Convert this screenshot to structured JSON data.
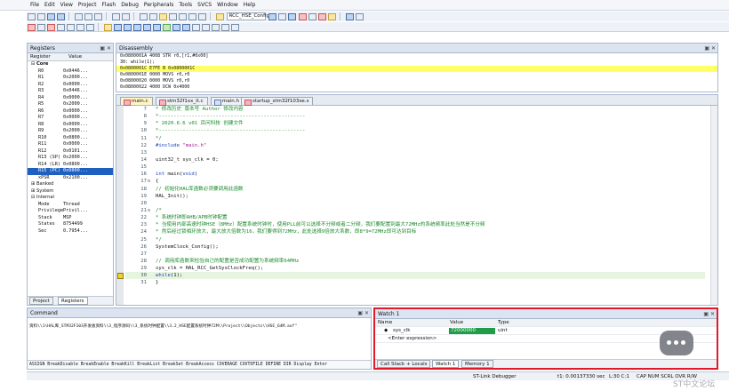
{
  "menu": [
    "File",
    "Edit",
    "View",
    "Project",
    "Flash",
    "Debug",
    "Peripherals",
    "Tools",
    "SVCS",
    "Window",
    "Help"
  ],
  "toolbar": {
    "target_dropdown": "RCC_HSE_Config"
  },
  "registers": {
    "title": "Registers",
    "col_register": "Register",
    "col_value": "Value",
    "core_label": "Core",
    "rows": [
      {
        "name": "R0",
        "value": "0x0446..."
      },
      {
        "name": "R1",
        "value": "0x2000..."
      },
      {
        "name": "R2",
        "value": "0x0000..."
      },
      {
        "name": "R3",
        "value": "0x0446..."
      },
      {
        "name": "R4",
        "value": "0x0000..."
      },
      {
        "name": "R5",
        "value": "0x2000..."
      },
      {
        "name": "R6",
        "value": "0x0000..."
      },
      {
        "name": "R7",
        "value": "0x0000..."
      },
      {
        "name": "R8",
        "value": "0x0000..."
      },
      {
        "name": "R9",
        "value": "0x2000..."
      },
      {
        "name": "R10",
        "value": "0x0800..."
      },
      {
        "name": "R11",
        "value": "0x0000..."
      },
      {
        "name": "R12",
        "value": "0x0101..."
      },
      {
        "name": "R13 (SP)",
        "value": "0x2000..."
      },
      {
        "name": "R14 (LR)",
        "value": "0x0800..."
      },
      {
        "name": "R15 (PC)",
        "value": "0x0800..."
      },
      {
        "name": "xPSR",
        "value": "0x2100..."
      }
    ],
    "banked": "Banked",
    "system": "System",
    "internal": "Internal",
    "internal_rows": [
      {
        "name": "Mode",
        "value": "Thread"
      },
      {
        "name": "Privilege",
        "value": "Privil..."
      },
      {
        "name": "Stack",
        "value": "MSP"
      },
      {
        "name": "States",
        "value": "8754499"
      },
      {
        "name": "Sec",
        "value": "0.7954..."
      }
    ],
    "tab_project": "Project",
    "tab_registers": "Registers"
  },
  "disassembly": {
    "title": "Disassembly",
    "rows": [
      {
        "text": "0x0800001A 4008      STR     r0,[r1,#0x00]",
        "highlight": false
      },
      {
        "text": "    30:      while(1);",
        "highlight": false
      },
      {
        "text": "0x0800001C E7FE      B       0x0800001C",
        "highlight": true
      },
      {
        "text": "0x0800001E 0000      MOVS    r0,r0",
        "highlight": false
      },
      {
        "text": "0x08000020 0000      MOVS    r0,r0",
        "highlight": false
      },
      {
        "text": "0x08000022 4000      DCW     0x4000",
        "highlight": false
      }
    ]
  },
  "editor": {
    "tabs": [
      "main.c",
      "stm32f1xx_it.c",
      "main.h",
      "startup_stm32f103xe.s"
    ],
    "lines": [
      {
        "n": "7",
        "fold": "",
        "html": "<span class='cmt'>  *  修改历史      版本号      Author      修改内容</span>"
      },
      {
        "n": "8",
        "fold": "",
        "html": "<span class='cmt'>  *-------------------------------------------------</span>"
      },
      {
        "n": "9",
        "fold": "",
        "html": "<span class='cmt'>  *  2020.6.6      v01         百问科技         创建文件</span>"
      },
      {
        "n": "10",
        "fold": "",
        "html": "<span class='cmt'>  *-------------------------------------------------</span>"
      },
      {
        "n": "11",
        "fold": "",
        "html": "<span class='cmt'> */</span>"
      },
      {
        "n": "12",
        "fold": "",
        "html": "<span class='kw'>#include</span> <span class='str'>\"main.h\"</span>"
      },
      {
        "n": "13",
        "fold": "",
        "html": ""
      },
      {
        "n": "14",
        "fold": "",
        "html": "uint32_t sys_clk = 0;"
      },
      {
        "n": "15",
        "fold": "",
        "html": ""
      },
      {
        "n": "16",
        "fold": "",
        "html": "<span class='kw'>int</span> main(<span class='kw'>void</span>)"
      },
      {
        "n": "17",
        "fold": "⊟",
        "html": "{"
      },
      {
        "n": "18",
        "fold": "",
        "html": "    <span class='cmt'>// 初始化HAL库函数必须要调用此函数</span>"
      },
      {
        "n": "19",
        "fold": "",
        "html": "    HAL_Init();"
      },
      {
        "n": "20",
        "fold": "",
        "html": ""
      },
      {
        "n": "21",
        "fold": "⊟",
        "html": "    <span class='cmt'>/*</span>"
      },
      {
        "n": "22",
        "fold": "",
        "html": "<span class='cmt'>     * 系统时钟即AHB/APB时钟配置</span>"
      },
      {
        "n": "23",
        "fold": "",
        "html": "<span class='cmt'>     * 当使用内部高速时钟HSE（8MHz）配置系统时钟时，使用PLL前可以选择不分频或者二分频，我们要配置到最大72MHz的系统频率此处当然是不分频</span>"
      },
      {
        "n": "24",
        "fold": "",
        "html": "<span class='cmt'>     * 然后经过锁相环放大，最大放大倍数为16，我们要得到72MHz，此处选择9倍放大系数，即8*9=72MHz即可达到目标</span>"
      },
      {
        "n": "25",
        "fold": "",
        "html": "<span class='cmt'>     */</span>"
      },
      {
        "n": "26",
        "fold": "",
        "html": "    SystemClock_Config();"
      },
      {
        "n": "27",
        "fold": "",
        "html": ""
      },
      {
        "n": "28",
        "fold": "",
        "html": "    <span class='cmt'>// 调用库函数来检验自己的配置是否成功配置为系统频率64MHz</span>"
      },
      {
        "n": "29",
        "fold": "",
        "html": "    sys_clk = HAL_RCC_GetSysClockFreq();"
      },
      {
        "n": "30",
        "fold": "",
        "html": "    <span class='kw'>while</span>(1);"
      },
      {
        "n": "31",
        "fold": "",
        "html": "}"
      }
    ]
  },
  "command": {
    "title": "Command",
    "line": "资料\\\\1\\HAL库_STM32F103开发板资料\\\\3_程序源码\\\\3_系统时钟配置\\\\3.2_HSE配置系统时钟72M\\\\Project\\\\Objects\\\\HSE_64M.axf\"",
    "bottom": "ASSIGN BreakDisable BreakEnable BreakKill BreakList BreakSet BreakAccess COVERAGE COVTOFILE DEFINE DIR Display Enter"
  },
  "watch": {
    "title": "Watch 1",
    "col_name": "Name",
    "col_value": "Value",
    "col_type": "Type",
    "rows": [
      {
        "name": "sys_clk",
        "value": "72000000",
        "type": "uint"
      },
      {
        "name": "<Enter expression>",
        "value": "",
        "type": ""
      }
    ],
    "tabs": [
      "Call Stack + Locals",
      "Watch 1",
      "Memory 1"
    ]
  },
  "status": {
    "debugger": "ST-Link Debugger",
    "time": "t1: 0.00137330 sec",
    "position": "L:30 C:1",
    "caps": "CAP NUM SCRL OVR R/W"
  },
  "watermark": "ST中文论坛",
  "colors": {
    "highlight_box": "#e0192d",
    "selection": "#1f5fbf",
    "pc_line": "#ffff66",
    "watch_value": "#1f9d47"
  }
}
